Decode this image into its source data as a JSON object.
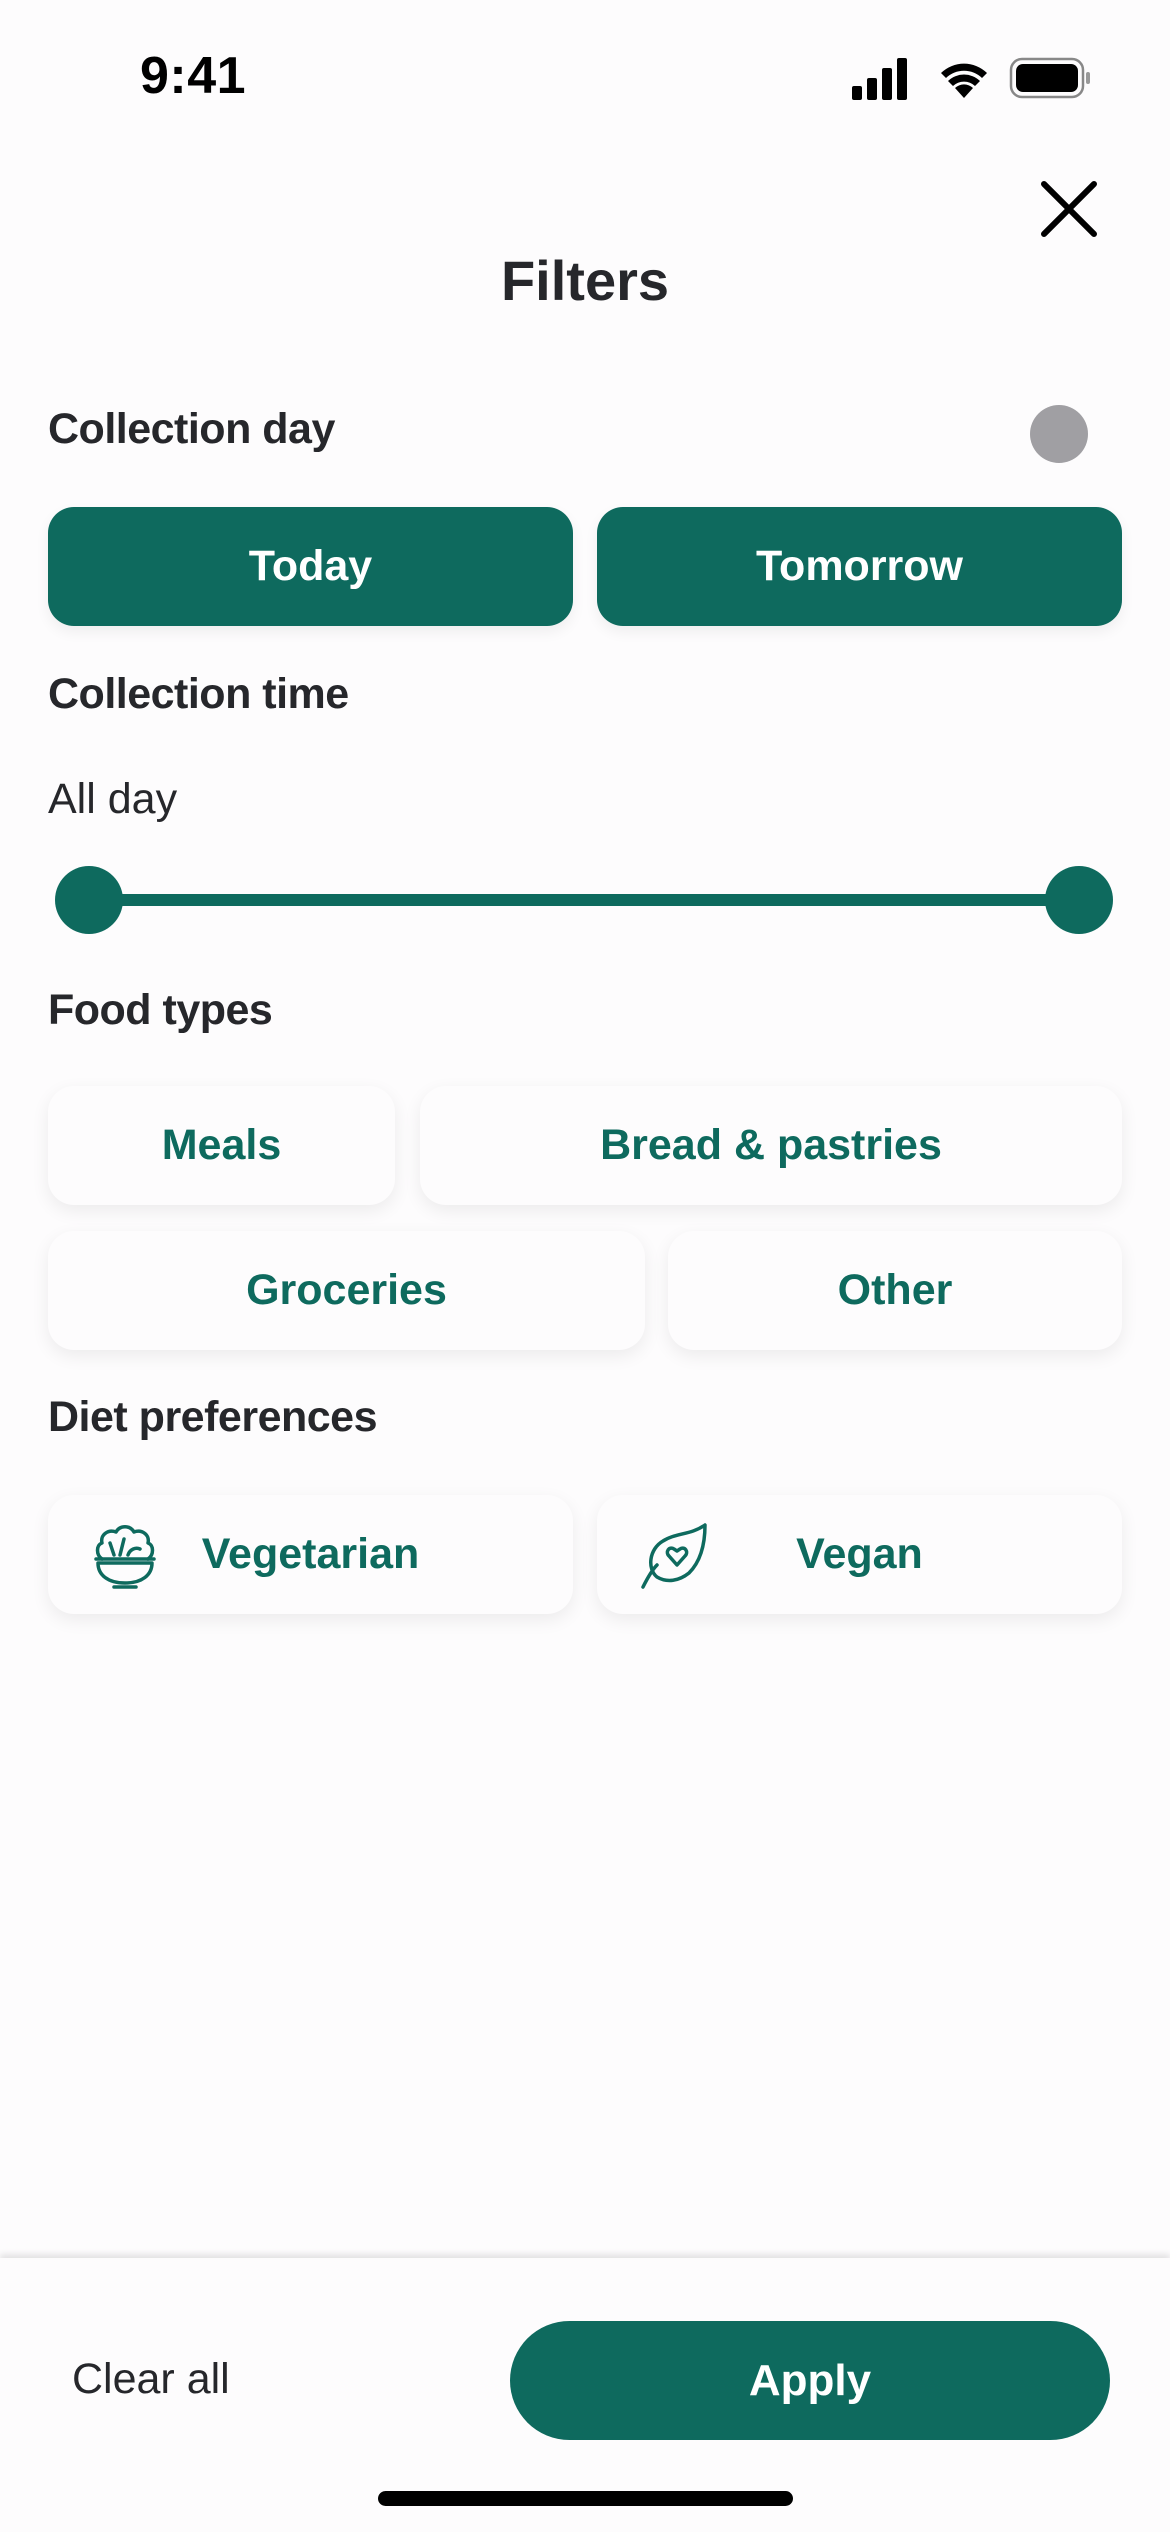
{
  "status_bar": {
    "time": "9:41",
    "icons": [
      "cellular-signal-icon",
      "wifi-icon",
      "battery-icon"
    ]
  },
  "header": {
    "title": "Filters",
    "close_icon": "close-icon"
  },
  "collection_day": {
    "title": "Collection day",
    "toggle_state": "off",
    "options": [
      {
        "label": "Today",
        "selected": true
      },
      {
        "label": "Tomorrow",
        "selected": true
      }
    ]
  },
  "collection_time": {
    "title": "Collection time",
    "value_label": "All day",
    "range": {
      "start_fraction": 0,
      "end_fraction": 1
    }
  },
  "food_types": {
    "title": "Food types",
    "options": [
      {
        "label": "Meals",
        "selected": false
      },
      {
        "label": "Bread & pastries",
        "selected": false
      },
      {
        "label": "Groceries",
        "selected": false
      },
      {
        "label": "Other",
        "selected": false
      }
    ]
  },
  "diet_preferences": {
    "title": "Diet preferences",
    "options": [
      {
        "label": "Vegetarian",
        "icon": "salad-bowl-icon",
        "selected": false
      },
      {
        "label": "Vegan",
        "icon": "leaf-heart-icon",
        "selected": false
      }
    ]
  },
  "footer": {
    "clear_label": "Clear all",
    "apply_label": "Apply"
  },
  "colors": {
    "brand": "#0e6a5e",
    "text": "#26272b",
    "toggle_off": "#a09fa3",
    "background": "#fdfcfd"
  }
}
